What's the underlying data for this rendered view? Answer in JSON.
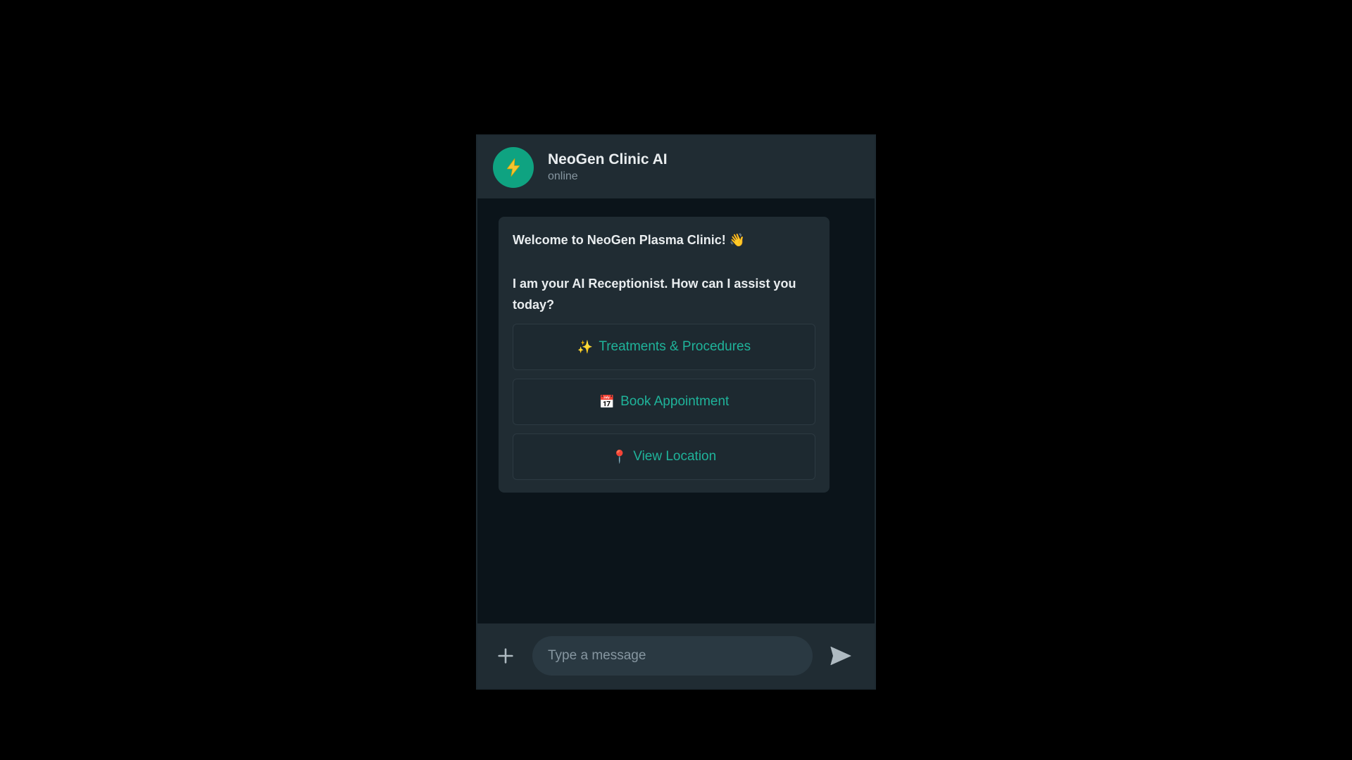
{
  "header": {
    "title": "NeoGen Clinic AI",
    "status": "online",
    "avatar_icon": "lightning-bolt-icon"
  },
  "message": {
    "line1": "Welcome to NeoGen Plasma Clinic! 👋",
    "line2": "I am your AI Receptionist. How can I assist you today?"
  },
  "options": [
    {
      "emoji": "✨",
      "label": "Treatments & Procedures",
      "icon": "sparkles-icon"
    },
    {
      "emoji": "📅",
      "label": "Book Appointment",
      "icon": "calendar-icon"
    },
    {
      "emoji": "📍",
      "label": "View Location",
      "icon": "pin-icon"
    }
  ],
  "composer": {
    "placeholder": "Type a message",
    "value": ""
  },
  "colors": {
    "accent": "#1fb39a",
    "avatar": "#0fa381",
    "panel": "#202c33",
    "background": "#0b141a"
  }
}
